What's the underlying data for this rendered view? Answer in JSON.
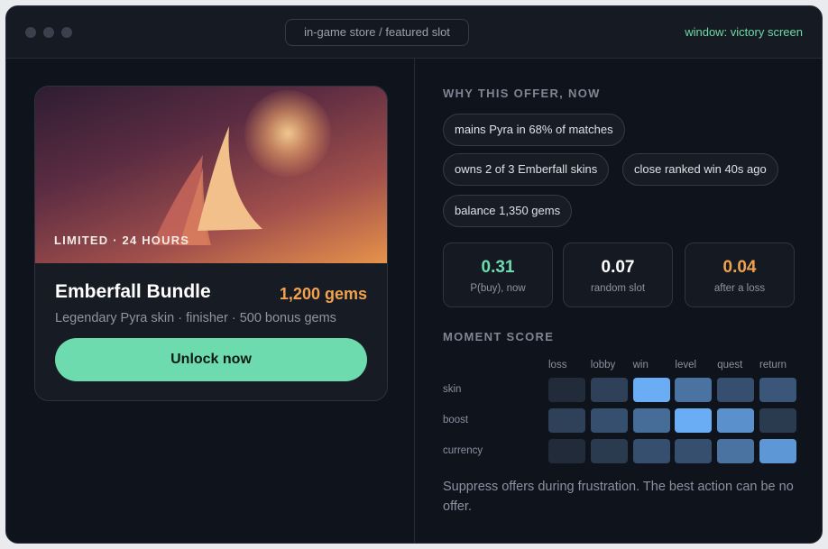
{
  "window": {
    "address": "in-game store / featured slot",
    "status": "window: victory screen"
  },
  "offer": {
    "tagline": "LIMITED · 24 HOURS",
    "title": "Emberfall Bundle",
    "price": "1,200 gems",
    "subtitle": "Legendary Pyra skin · finisher · 500 bonus gems",
    "cta": "Unlock now"
  },
  "why": {
    "heading": "WHY THIS OFFER, NOW",
    "chips": [
      "mains Pyra in 68% of matches",
      "owns 2 of 3 Emberfall skins",
      "close ranked win 40s ago",
      "balance 1,350 gems"
    ]
  },
  "stats": [
    {
      "value": "0.31",
      "label": "P(buy), now",
      "color": "#6ddbae"
    },
    {
      "value": "0.07",
      "label": "random slot",
      "color": "#ffffff"
    },
    {
      "value": "0.04",
      "label": "after a loss",
      "color": "#f0a24e"
    }
  ],
  "moment": {
    "heading": "MOMENT SCORE",
    "columns": [
      "loss",
      "lobby",
      "win",
      "level",
      "quest",
      "return"
    ],
    "rows": [
      {
        "label": "skin",
        "levels": [
          0.05,
          0.2,
          0.95,
          0.55,
          0.3,
          0.35
        ]
      },
      {
        "label": "boost",
        "levels": [
          0.2,
          0.3,
          0.5,
          0.95,
          0.75,
          0.15
        ]
      },
      {
        "label": "currency",
        "levels": [
          0.05,
          0.15,
          0.3,
          0.3,
          0.55,
          0.8
        ]
      }
    ]
  },
  "note": "Suppress offers during frustration. The best action can be no offer."
}
